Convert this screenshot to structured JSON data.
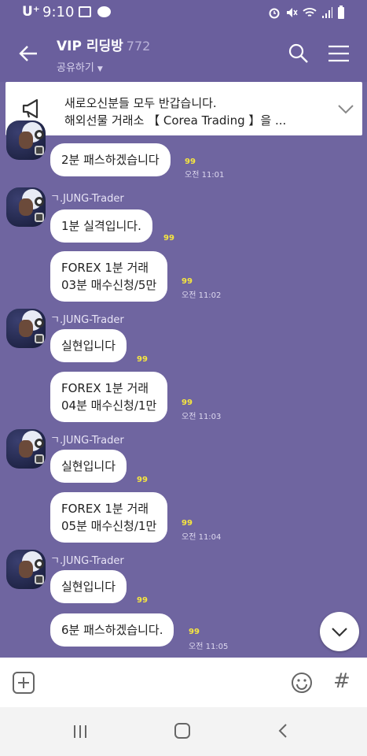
{
  "status_bar": {
    "carrier": "U⁺",
    "time": "9:10",
    "left_icons": [
      "image-icon",
      "talk-icon"
    ],
    "right_icons": [
      "alarm-icon",
      "mute-icon",
      "wifi-icon",
      "signal-icon",
      "battery-icon"
    ]
  },
  "header": {
    "title": "VIP 리딩방",
    "member_count": "772",
    "subtitle": "공유하기",
    "icons": [
      "back-arrow-icon",
      "search-icon",
      "menu-icon"
    ]
  },
  "notice": {
    "line1": "새로오신분들 모두 반갑습니다.",
    "line2": "해외선물 거래소 【 Corea Trading 】을 ...",
    "icons": [
      "megaphone-icon",
      "chevron-down-icon"
    ]
  },
  "messages": [
    {
      "sender": "",
      "text": "2분 패스하겠습니다",
      "unread": "99",
      "time": "오전 11:01"
    },
    {
      "sender": "ㄱ.JUNG-Trader",
      "text": "1분 실격입니다.",
      "unread": "99",
      "time": ""
    },
    {
      "sender": "",
      "text": "FOREX 1분 거래",
      "text2": "03분 매수신청/5만",
      "unread": "99",
      "time": "오전 11:02"
    },
    {
      "sender": "ㄱ.JUNG-Trader",
      "text": "실현입니다",
      "unread": "99",
      "time": ""
    },
    {
      "sender": "",
      "text": "FOREX 1분 거래",
      "text2": "04분 매수신청/1만",
      "unread": "99",
      "time": "오전 11:03"
    },
    {
      "sender": "ㄱ.JUNG-Trader",
      "text": "실현입니다",
      "unread": "99",
      "time": ""
    },
    {
      "sender": "",
      "text": "FOREX 1분 거래",
      "text2": "05분 매수신청/1만",
      "unread": "99",
      "time": "오전 11:04"
    },
    {
      "sender": "ㄱ.JUNG-Trader",
      "text": "실현입니다",
      "unread": "99",
      "time": ""
    },
    {
      "sender": "",
      "text": "6분 패스하겠습니다.",
      "unread": "99",
      "time": "오전 11:05"
    }
  ],
  "input_bar": {
    "icons": [
      "plus-icon",
      "emoji-icon",
      "hash-icon"
    ],
    "hash_label": "#"
  },
  "nav_bar": {
    "icons": [
      "recent-apps-icon",
      "home-icon",
      "back-icon"
    ]
  },
  "colors": {
    "background": "#6f65a0",
    "header": "#6a5f9d",
    "unread": "#f6e63f"
  }
}
